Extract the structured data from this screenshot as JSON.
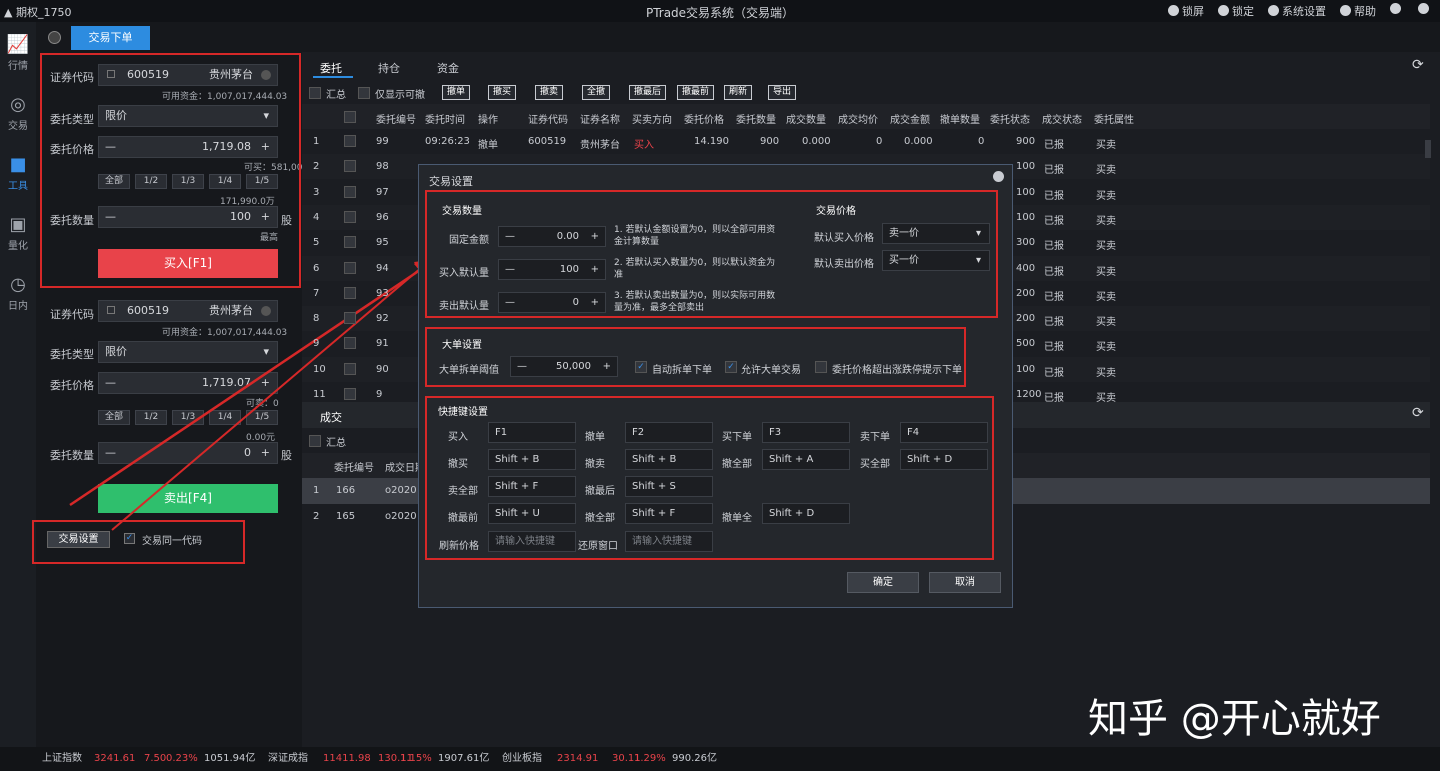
{
  "titlebar": {
    "account": "期权_1750",
    "app_title": "PTrade交易系统（交易端）",
    "menu": [
      "锁屏",
      "锁定",
      "系统设置",
      "帮助"
    ]
  },
  "sidenav": [
    "行情",
    "交易",
    "工具",
    "量化",
    "日内"
  ],
  "order_tab": "交易下单",
  "buy_form": {
    "code_label": "证券代码",
    "code_value": "600519",
    "name_value": "贵州茅台",
    "avail_note": "可用资金：1,007,017,444.03",
    "type_label": "委托类型",
    "type_value": "限价",
    "price_label": "委托价格",
    "price_value": "1,719.08",
    "limit_note": "可买：581,000",
    "frac_buttons": [
      "全部",
      "1/2",
      "1/3",
      "1/4",
      "1/5"
    ],
    "max_note": "171,990.0万",
    "qty_label": "委托数量",
    "qty_value": "100",
    "qty_unit": "股",
    "qty_hint": "最高",
    "button": "买入[F1]"
  },
  "sell_form": {
    "code_label": "证券代码",
    "code_value": "600519",
    "name_value": "贵州茅台",
    "avail_note": "可用资金：1,007,017,444.03",
    "type_label": "委托类型",
    "type_value": "限价",
    "price_label": "委托价格",
    "price_value": "1,719.07",
    "limit_note": "可卖：0",
    "frac_buttons": [
      "全部",
      "1/2",
      "1/3",
      "1/4",
      "1/5"
    ],
    "max_note": "0.00元",
    "qty_label": "委托数量",
    "qty_value": "0",
    "qty_unit": "股",
    "button": "卖出[F4]"
  },
  "bottom_left": {
    "settings_button": "交易设置",
    "checkbox_label": "交易同一代码"
  },
  "right": {
    "tabs": [
      "委托",
      "持仓",
      "资金"
    ],
    "summary_label": "汇总",
    "only_cancel_label": "仅显示可撤",
    "tool_buttons": [
      "撤单",
      "撤买",
      "撤卖",
      "全撤",
      "撤最后",
      "撤最前",
      "刷新",
      "导出"
    ],
    "columns": [
      "委托编号",
      "委托时间",
      "操作",
      "证券代码",
      "证券名称",
      "买卖方向",
      "委托价格",
      "委托数量",
      "成交数量",
      "成交均价",
      "成交金额",
      "撤单数量",
      "委托状态",
      "成交状态",
      "委托属性"
    ],
    "rows": [
      {
        "n": "1",
        "id": "99",
        "time": "09:26:23",
        "op": "撤单",
        "code": "600519",
        "name": "贵州茅台",
        "dir": "买入",
        "price": "14.190",
        "qty": "900",
        "deal": "0.000",
        "avg": "0",
        "amt": "0.000",
        "cancel": "0",
        "vol": "900",
        "status": "已报",
        "attr": "买卖"
      },
      {
        "n": "2",
        "id": "98",
        "vol": "100",
        "status": "已报",
        "attr": "买卖"
      },
      {
        "n": "3",
        "id": "97",
        "vol": "100",
        "status": "已报",
        "attr": "买卖"
      },
      {
        "n": "4",
        "id": "96",
        "vol": "100",
        "status": "已报",
        "attr": "买卖"
      },
      {
        "n": "5",
        "id": "95",
        "vol": "300",
        "status": "已报",
        "attr": "买卖"
      },
      {
        "n": "6",
        "id": "94",
        "vol": "400",
        "status": "已报",
        "attr": "买卖"
      },
      {
        "n": "7",
        "id": "93",
        "vol": "200",
        "status": "已报",
        "attr": "买卖"
      },
      {
        "n": "8",
        "id": "92",
        "vol": "200",
        "status": "已报",
        "attr": "买卖"
      },
      {
        "n": "9",
        "id": "91",
        "vol": "500",
        "status": "已报",
        "attr": "买卖"
      },
      {
        "n": "10",
        "id": "90",
        "vol": "100",
        "status": "已报",
        "attr": "买卖"
      },
      {
        "n": "11",
        "id": "9",
        "vol": "1200",
        "status": "已报",
        "attr": "买卖"
      }
    ],
    "deal_tab": "成交",
    "deal_summary": "汇总",
    "deal_columns": [
      "委托编号",
      "成交日期"
    ],
    "deal_rows": [
      {
        "n": "1",
        "id": "166",
        "date": "o2020"
      },
      {
        "n": "2",
        "id": "165",
        "date": "o2020"
      }
    ]
  },
  "dialog": {
    "title": "交易设置",
    "sec1": "交易数量",
    "fixed_amount_label": "固定金额",
    "fixed_amount_value": "0.00",
    "fixed_amount_note": "1. 若默认金额设置为0，则以全部可用资金计算数量",
    "buy_default_label": "买入默认量",
    "buy_default_value": "100",
    "buy_default_note": "2. 若默认买入数量为0，则以默认资金为准",
    "sell_default_label": "卖出默认量",
    "sell_default_value": "0",
    "sell_default_note": "3. 若默认卖出数量为0，则以实际可用数量为准，最多全部卖出",
    "sec_price": "交易价格",
    "buy_price_label": "默认买入价格",
    "buy_price_value": "卖一价",
    "sell_price_label": "默认卖出价格",
    "sell_price_value": "买一价",
    "sec2": "大单设置",
    "bigorder_label": "大单拆单阈值",
    "bigorder_value": "50,000",
    "cb1": "自动拆单下单",
    "cb2": "允许大单交易",
    "cb3": "委托价格超出涨跌停提示下单",
    "sec3": "快捷键设置",
    "hotkeys": [
      [
        "买入",
        "F1"
      ],
      [
        "撤单",
        "F2"
      ],
      [
        "买下单",
        "F3"
      ],
      [
        "卖下单",
        "F4"
      ],
      [
        "撤买",
        "Shift + B"
      ],
      [
        "撤卖",
        "Shift + B"
      ],
      [
        "撤全部",
        "Shift + A"
      ],
      [
        "买全部",
        "Shift + D"
      ],
      [
        "卖全部",
        "Shift + F"
      ],
      [
        "撤最后",
        "Shift + S"
      ],
      [
        "撤最前",
        "Shift + U"
      ],
      [
        "撤全部",
        "Shift + F"
      ],
      [
        "撤单全",
        "Shift + D"
      ]
    ],
    "hot_price_label": "刷新价格",
    "hot_price_placeholder": "请输入快捷键",
    "hot_window_label": "还原窗口",
    "hot_window_placeholder": "请输入快捷键",
    "ok": "确定",
    "cancel": "取消"
  },
  "statusbar": [
    {
      "t": "上证指数",
      "c": "gray"
    },
    {
      "t": "3241.61",
      "c": "red"
    },
    {
      "t": "7.50",
      "c": "red"
    },
    {
      "t": "0.23%",
      "c": "red"
    },
    {
      "t": "1051.94亿",
      "c": "gray"
    },
    {
      "t": "深证成指",
      "c": "gray"
    },
    {
      "t": "11411.98",
      "c": "red"
    },
    {
      "t": "130.11",
      "c": "red"
    },
    {
      "t": "1.15%",
      "c": "red"
    },
    {
      "t": "1907.61亿",
      "c": "gray"
    },
    {
      "t": "创业板指",
      "c": "gray"
    },
    {
      "t": "2314.91",
      "c": "red"
    },
    {
      "t": "30.11",
      "c": "red"
    },
    {
      "t": "1.29%",
      "c": "red"
    },
    {
      "t": "990.26亿",
      "c": "gray"
    }
  ],
  "watermark": "知乎 @开心就好",
  "colors": {
    "accent": "#2d8ce0",
    "buy": "#e8434a",
    "sell": "#2fbf6d",
    "highlight": "#d62828"
  }
}
